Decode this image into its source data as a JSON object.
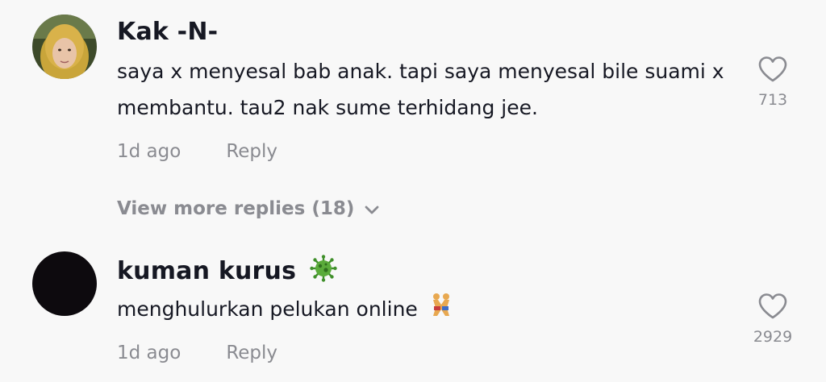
{
  "comments": [
    {
      "username": "Kak -N-",
      "text": "saya x menyesal bab anak. tapi saya menyesal bile suami x membantu. tau2 nak sume terhidang jee.",
      "time": "1d ago",
      "reply_label": "Reply",
      "like_count": "713",
      "view_more": "View more replies (18)"
    },
    {
      "username": "kuman kurus",
      "username_emoji": "virus-emoji",
      "text": "menghulurkan pelukan online",
      "text_emoji": "wrestlers-emoji",
      "time": "1d ago",
      "reply_label": "Reply",
      "like_count": "2929"
    }
  ],
  "colors": {
    "background": "#f8f8f8",
    "text_primary": "#161823",
    "text_secondary": "#8a8b91",
    "avatar_dark": "#0d0a0e",
    "hijab": "#c9a53a"
  }
}
